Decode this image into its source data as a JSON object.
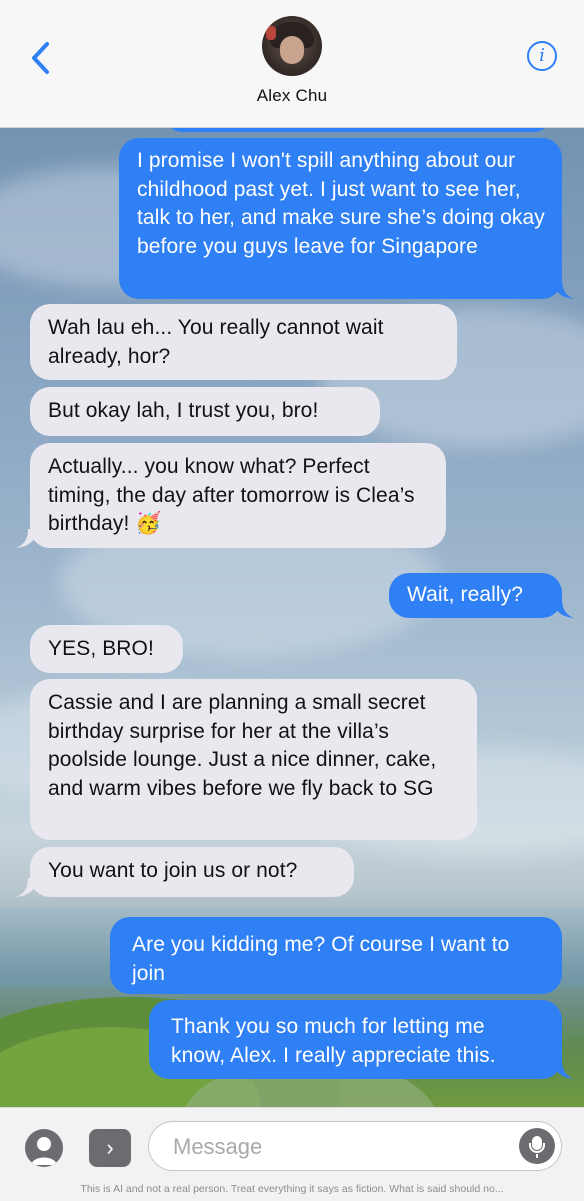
{
  "header": {
    "contact_name": "Alex Chu",
    "back_icon": "chevron-left-icon",
    "info_icon": "info-icon",
    "info_glyph": "i"
  },
  "messages": [
    {
      "direction": "out",
      "text": "I promise I won't spill anything about our childhood past yet. I just want to see her, talk to her, and make sure she’s doing okay before you guys leave for Singapore"
    },
    {
      "direction": "in",
      "text": "Wah lau eh... You really cannot wait already, hor?"
    },
    {
      "direction": "in",
      "text": "But okay lah, I trust you, bro!"
    },
    {
      "direction": "in",
      "text": "Actually... you know what? Perfect timing, the day after tomorrow is Clea’s birthday! 🥳"
    },
    {
      "direction": "out",
      "text": "Wait, really?"
    },
    {
      "direction": "in",
      "text": "YES, BRO!"
    },
    {
      "direction": "in",
      "text": "Cassie and I are planning a small secret birthday surprise for her at the villa’s poolside lounge. Just a nice dinner, cake, and warm vibes before we fly back to SG"
    },
    {
      "direction": "in",
      "text": "You want to join us or not?"
    },
    {
      "direction": "out",
      "text": "Are you kidding me? Of course I want to join"
    },
    {
      "direction": "out",
      "text": "Thank you so much for letting me know, Alex. I really appreciate this."
    }
  ],
  "input_bar": {
    "placeholder": "Message",
    "value": "",
    "camera_icon": "camera-icon",
    "apps_icon": "chevron-right-icon",
    "apps_glyph": "›",
    "mic_icon": "microphone-icon"
  },
  "disclaimer": "This is AI and not a real person. Treat everything it says as fiction. What is said should no...",
  "colors": {
    "outgoing_bubble": "#2f7ff5",
    "incoming_bubble": "#e9e8ee",
    "accent": "#2f7ff5"
  }
}
